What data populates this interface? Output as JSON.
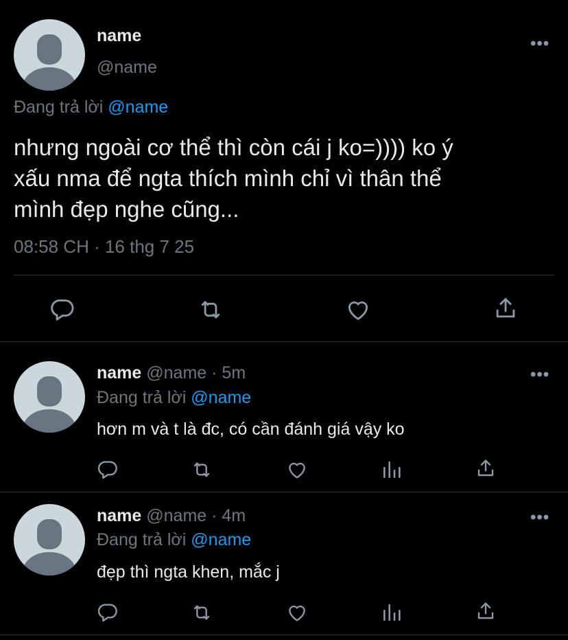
{
  "main_tweet": {
    "display_name": "name",
    "handle": "@name",
    "replying_prefix": "Đang trả lời",
    "replying_to": "@name",
    "text_lines": [
      "nhưng ngoài cơ thể thì còn cái j ko=)))) ko ý",
      "xấu nma để ngta thích mình chỉ vì thân thể",
      "mình đẹp nghe cũng..."
    ],
    "timestamp": "08:58 CH · 16 thg 7 25",
    "more_label": "•••",
    "actions": [
      "reply-icon",
      "retweet-icon",
      "like-icon",
      "share-icon"
    ]
  },
  "replies": [
    {
      "display_name": "name",
      "handle": "@name",
      "dot": "·",
      "time": "5m",
      "replying_prefix": "Đang trả lời",
      "replying_to": "@name",
      "text": "hơn m và t là đc, có cần đánh giá vậy ko",
      "more_label": "•••",
      "actions": [
        "reply-icon",
        "retweet-icon",
        "like-icon",
        "analytics-icon",
        "share-icon"
      ]
    },
    {
      "display_name": "name",
      "handle": "@name",
      "dot": "·",
      "time": "4m",
      "replying_prefix": "Đang trả lời",
      "replying_to": "@name",
      "text": "đẹp thì ngta khen, mắc j",
      "more_label": "•••",
      "actions": [
        "reply-icon",
        "retweet-icon",
        "like-icon",
        "analytics-icon",
        "share-icon"
      ]
    }
  ],
  "colors": {
    "background": "#000000",
    "text": "#e7e9ea",
    "muted": "#6e767d",
    "link": "#1d9bf0",
    "divider": "#2f3336",
    "avatar_bg": "#ccd6dd",
    "avatar_fg": "#66757f"
  }
}
